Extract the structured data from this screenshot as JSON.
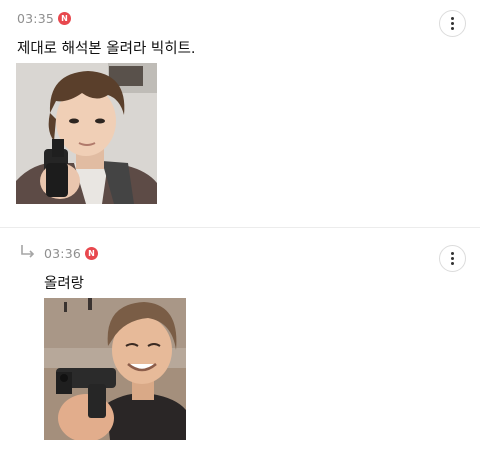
{
  "comments": [
    {
      "time": "03:35",
      "badge": "N",
      "text": "제대로 해석본 올려라 빅히트.",
      "is_reply": false
    },
    {
      "time": "03:36",
      "badge": "N",
      "text": "올려랑",
      "is_reply": true
    }
  ],
  "icons": {
    "more": "more-vertical-icon",
    "reply": "reply-arrow-icon",
    "new_badge": "new-badge-icon"
  },
  "colors": {
    "badge": "#e8484e",
    "time": "#8f8f8f",
    "divider": "#ececec"
  }
}
